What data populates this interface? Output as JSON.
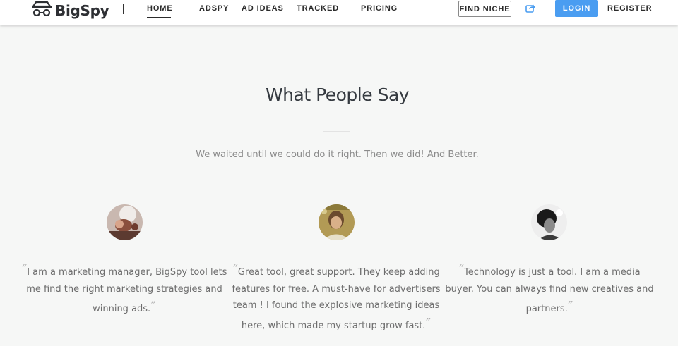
{
  "nav": {
    "brand": "BigSpy",
    "items": [
      "HOME",
      "ADSPY",
      "AD IDEAS",
      "TRACKED",
      "PRICING"
    ],
    "find_niche": "FIND NICHE",
    "login": "LOGIN",
    "register": "REGISTER",
    "accent": "#4a9df1"
  },
  "section": {
    "title": "What People Say",
    "subtitle": "We waited until we could do it right. Then we did! And Better."
  },
  "testimonials": [
    {
      "quote": "I am a marketing manager, BigSpy tool lets me find the right marketing strategies and winning ads."
    },
    {
      "quote": "Great tool, great support. They keep adding features for free. A must-have for advertisers team ! I found the explosive marketing ideas here, which made my startup grow fast."
    },
    {
      "quote": "Technology is just a tool. I am a media buyer. You can always find new creatives and partners."
    }
  ]
}
